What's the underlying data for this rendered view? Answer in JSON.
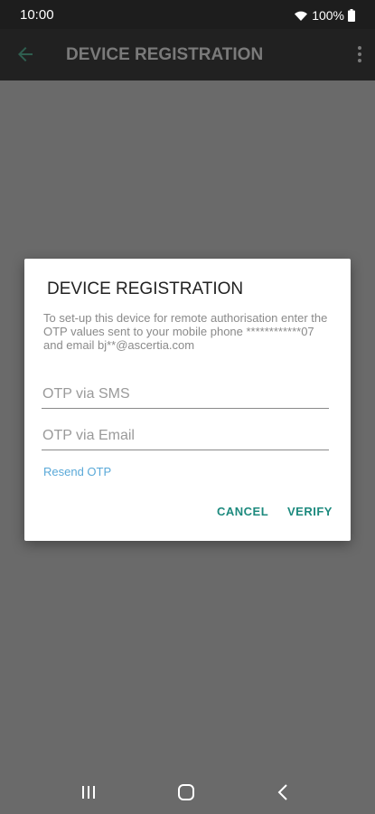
{
  "status_bar": {
    "time": "10:00",
    "battery_percent": "100%",
    "icons": [
      "wifi-icon",
      "battery-icon"
    ]
  },
  "app_bar": {
    "title": "DEVICE REGISTRATION",
    "back_icon": "arrow-back-icon",
    "menu_icon": "overflow-menu-icon"
  },
  "dialog": {
    "title": "DEVICE REGISTRATION",
    "message": "To set-up this device for remote authorisation enter the OTP values sent to your mobile phone ************07 and email bj**@ascertia.com",
    "sms_field": {
      "placeholder": "OTP via SMS",
      "value": ""
    },
    "email_field": {
      "placeholder": "OTP via Email",
      "value": ""
    },
    "resend_label": "Resend OTP",
    "cancel_label": "CANCEL",
    "verify_label": "VERIFY"
  },
  "nav_bar": {
    "icons": [
      "recents-icon",
      "home-icon",
      "back-icon"
    ]
  },
  "colors": {
    "accent": "#1d8a7e",
    "link": "#5aa9d8",
    "scrim": "#6a6a6a",
    "status_bar": "#1d1d1d"
  }
}
